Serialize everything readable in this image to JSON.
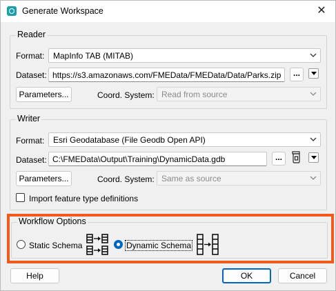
{
  "window": {
    "title": "Generate Workspace",
    "close_glyph": "✕"
  },
  "reader": {
    "group_title": "Reader",
    "format_label": "Format:",
    "format_value": "MapInfo TAB (MITAB)",
    "dataset_label": "Dataset:",
    "dataset_value": "https://s3.amazonaws.com/FMEData/FMEData/Data/Parks.zip",
    "browse_label": "...",
    "parameters_label": "Parameters...",
    "coord_label": "Coord. System:",
    "coord_placeholder": "Read from source"
  },
  "writer": {
    "group_title": "Writer",
    "format_label": "Format:",
    "format_value": "Esri Geodatabase (File Geodb Open API)",
    "dataset_label": "Dataset:",
    "dataset_value": "C:\\FMEData\\Output\\Training\\DynamicData.gdb",
    "browse_label": "...",
    "parameters_label": "Parameters...",
    "coord_label": "Coord. System:",
    "coord_placeholder": "Same as source",
    "import_label": "Import feature type definitions",
    "import_checked": false
  },
  "workflow": {
    "group_title": "Workflow Options",
    "static_label": "Static Schema",
    "dynamic_label": "Dynamic Schema",
    "selected": "Dynamic Schema"
  },
  "footer": {
    "help_label": "Help",
    "ok_label": "OK",
    "cancel_label": "Cancel"
  },
  "colors": {
    "accent": "#0067c0",
    "highlight": "#f05a1a",
    "app_icon": "#1aa0a8"
  }
}
